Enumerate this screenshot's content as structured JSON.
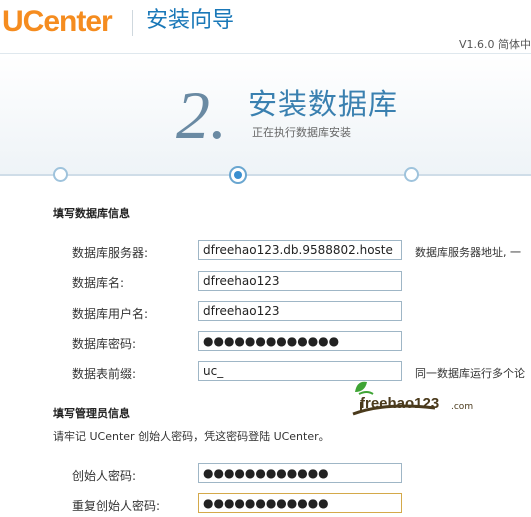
{
  "header": {
    "logo_text": "UCenter",
    "title": "安装向导",
    "version": "V1.6.0 简体中"
  },
  "step": {
    "number": "2.",
    "title": "安装数据库",
    "subtitle": "正在执行数据库安装"
  },
  "db_section": {
    "title": "填写数据库信息",
    "fields": [
      {
        "label": "数据库服务器:",
        "value": "dfreehao123.db.9588802.hoste",
        "hint": "数据库服务器地址, 一"
      },
      {
        "label": "数据库名:",
        "value": "dfreehao123",
        "hint": ""
      },
      {
        "label": "数据库用户名:",
        "value": "dfreehao123",
        "hint": ""
      },
      {
        "label": "数据库密码:",
        "value": "●●●●●●●●●●●●●",
        "hint": ""
      },
      {
        "label": "数据表前缀:",
        "value": "uc_",
        "hint": "同一数据库运行多个论"
      }
    ]
  },
  "admin_section": {
    "title": "填写管理员信息",
    "note": "请牢记 UCenter 创始人密码，凭这密码登陆 UCenter。",
    "fields": [
      {
        "label": "创始人密码:",
        "value": "●●●●●●●●●●●●"
      },
      {
        "label": "重复创始人密码:",
        "value": "●●●●●●●●●●●●"
      }
    ]
  },
  "watermark": {
    "text": "freehao123",
    "suffix": ".com"
  },
  "colors": {
    "logo": "#f58c1f",
    "title_blue": "#1a78b8",
    "field_border": "#9fb6c6",
    "focus_border": "#d4a94a"
  }
}
